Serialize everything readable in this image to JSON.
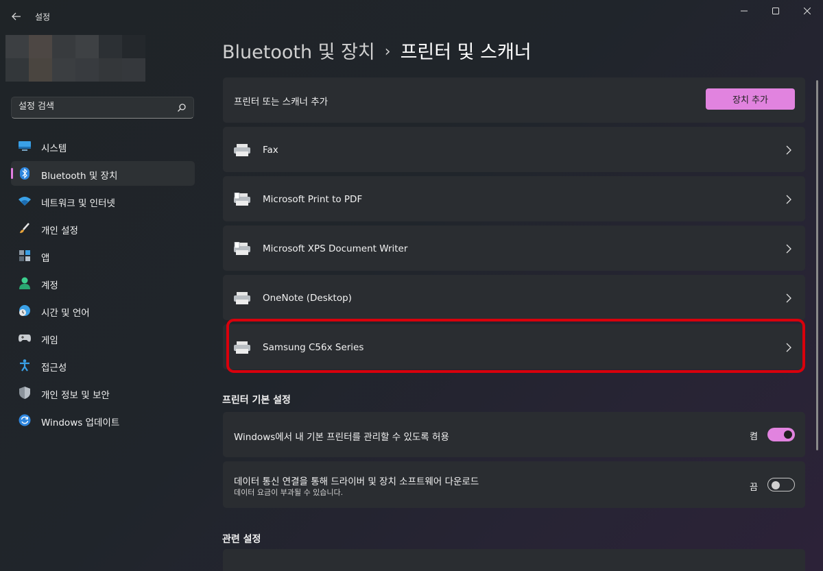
{
  "window": {
    "app_title": "설정"
  },
  "sidebar": {
    "search_placeholder": "설정 검색",
    "items": [
      {
        "label": "시스템",
        "icon": "monitor-icon"
      },
      {
        "label": "Bluetooth 및 장치",
        "icon": "bluetooth-icon",
        "active": true
      },
      {
        "label": "네트워크 및 인터넷",
        "icon": "wifi-icon"
      },
      {
        "label": "개인 설정",
        "icon": "brush-icon"
      },
      {
        "label": "앱",
        "icon": "apps-icon"
      },
      {
        "label": "계정",
        "icon": "account-icon"
      },
      {
        "label": "시간 및 언어",
        "icon": "globe-clock-icon"
      },
      {
        "label": "게임",
        "icon": "gamepad-icon"
      },
      {
        "label": "접근성",
        "icon": "accessibility-icon"
      },
      {
        "label": "개인 정보 및 보안",
        "icon": "shield-icon"
      },
      {
        "label": "Windows 업데이트",
        "icon": "update-icon"
      }
    ],
    "accent_color": "#e27ee0"
  },
  "header": {
    "breadcrumb_parent": "Bluetooth 및 장치",
    "breadcrumb_separator": "›",
    "breadcrumb_current": "프린터 및 스캐너"
  },
  "add_device": {
    "label": "프린터 또는 스캐너 추가",
    "button_label": "장치 추가"
  },
  "printers": [
    {
      "name": "Fax",
      "icon": "printer-icon"
    },
    {
      "name": "Microsoft Print to PDF",
      "icon": "printer-doc-icon"
    },
    {
      "name": "Microsoft XPS Document Writer",
      "icon": "printer-doc-icon"
    },
    {
      "name": "OneNote (Desktop)",
      "icon": "printer-icon"
    },
    {
      "name": "Samsung C56x Series",
      "icon": "printer-icon",
      "highlighted": true
    }
  ],
  "printer_prefs": {
    "title": "프린터 기본 설정",
    "items": [
      {
        "label": "Windows에서 내 기본 프린터를 관리할 수 있도록 허용",
        "state": "켬",
        "on": true
      },
      {
        "label": "데이터 통신 연결을 통해 드라이버 및 장치 소프트웨어 다운로드",
        "sublabel": "데이터 요금이 부과될 수 있습니다.",
        "state": "끔",
        "on": false
      }
    ]
  },
  "related": {
    "title": "관련 설정"
  },
  "colors": {
    "accent": "#e183df",
    "highlight_border": "#d8000c",
    "card_bg": "#2a2d31"
  }
}
